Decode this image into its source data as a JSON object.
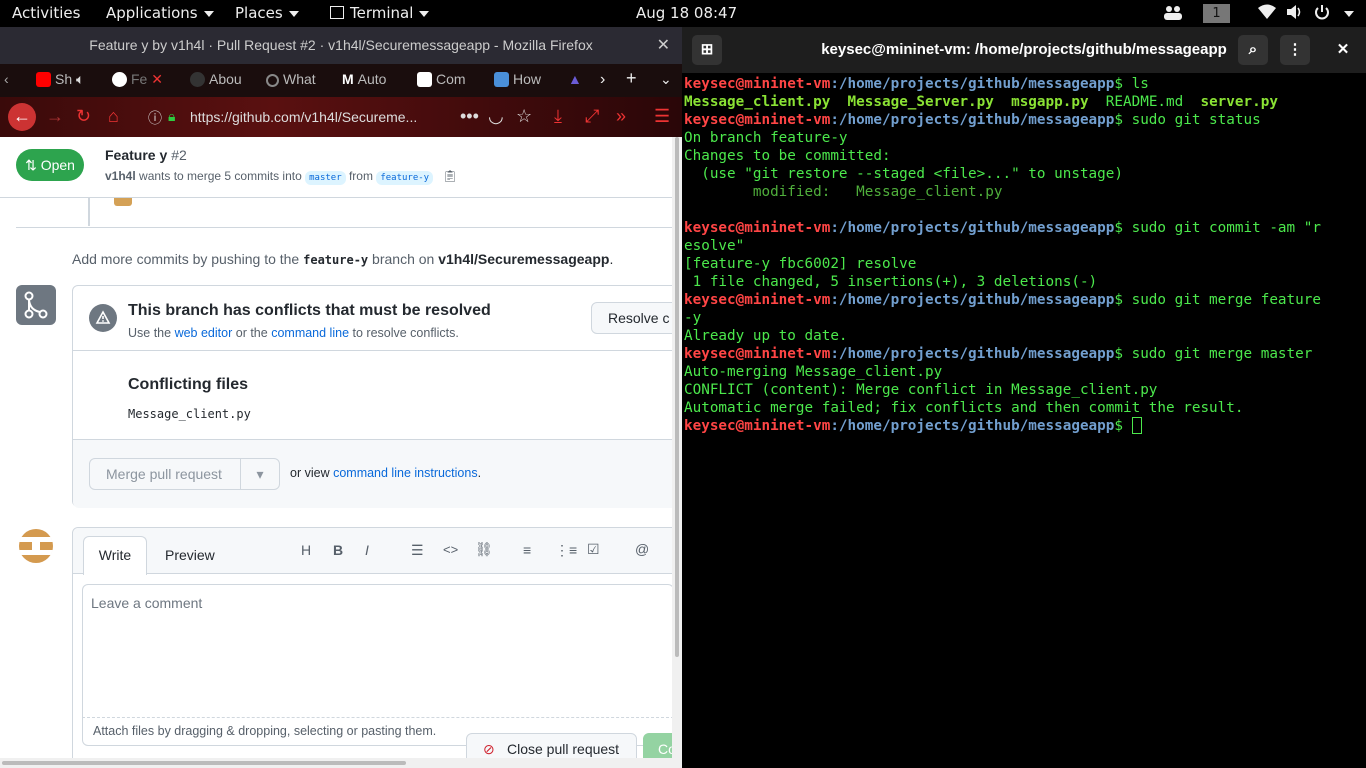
{
  "topbar": {
    "activities": "Activities",
    "applications": "Applications",
    "places": "Places",
    "terminal": "Terminal",
    "clock": "Aug 18  08:47",
    "workspace": "1"
  },
  "firefox": {
    "window_title": "Feature y by v1h4l · Pull Request #2 · v1h4l/Securemessageapp - Mozilla Firefox",
    "tabs": [
      {
        "label": "Sh",
        "icon": "youtube-icon"
      },
      {
        "label": "Fe",
        "icon": "github-icon"
      },
      {
        "label": "Abou",
        "icon": "github-icon"
      },
      {
        "label": "What",
        "icon": "circle-icon"
      },
      {
        "label": "Auto",
        "icon": "medium-icon"
      },
      {
        "label": "Com",
        "icon": "code-icon"
      },
      {
        "label": "How",
        "icon": "blog-icon"
      }
    ],
    "url": "https://github.com/v1h4l/Secureme..."
  },
  "pr": {
    "status": "Open",
    "title": "Feature y",
    "number": "#2",
    "author": "v1h4l",
    "merge_text": "wants to merge 5 commits into",
    "base_branch": "master",
    "from_word": "from",
    "head_branch": "feature-y",
    "add_commits_prefix": "Add more commits by pushing to the",
    "add_commits_branch": "feature-y",
    "add_commits_mid": "branch on",
    "add_commits_repo": "v1h4l/Securemessageapp",
    "add_commits_end": ".",
    "conflict_title": "This branch has conflicts that must be resolved",
    "conflict_use": "Use the",
    "web_editor": "web editor",
    "or_the": "or the",
    "command_line": "command line",
    "to_resolve": "to resolve conflicts.",
    "resolve_button": "Resolve c",
    "conflicting_files_title": "Conflicting files",
    "conflicting_file": "Message_client.py",
    "merge_button": "Merge pull request",
    "or_view": "or view",
    "cli_instructions": "command line instructions",
    "period": "."
  },
  "comment": {
    "write_tab": "Write",
    "preview_tab": "Preview",
    "placeholder": "Leave a comment",
    "attach_hint": "Attach files by dragging & dropping, selecting or pasting them.",
    "close_pr_button": "Close pull request",
    "comment_button": "Co"
  },
  "terminal": {
    "title": "keysec@mininet-vm: /home/projects/github/messageapp",
    "user_host": "keysec@mininet-vm",
    "path": ":/home/projects/github/messageapp",
    "prompt_end": "$ ",
    "cmd_ls": "ls",
    "ls_files": [
      "Message_client.py",
      "Message_Server.py",
      "msgapp.py",
      "README.md",
      "server.py"
    ],
    "cmd_status": "sudo git status",
    "status_lines": [
      "On branch feature-y",
      "Changes to be committed:",
      "  (use \"git restore --staged <file>...\" to unstage)",
      "        modified:   Message_client.py"
    ],
    "cmd_commit": "sudo git commit -am \"r",
    "cmd_commit_wrap": "esolve\"",
    "commit_lines": [
      "[feature-y fbc6002] resolve",
      " 1 file changed, 5 insertions(+), 3 deletions(-)"
    ],
    "cmd_merge_feature": "sudo git merge feature",
    "cmd_merge_feature_wrap": "-y",
    "merge_feature_out": "Already up to date.",
    "cmd_merge_master": "sudo git merge master",
    "merge_master_lines": [
      "Auto-merging Message_client.py",
      "CONFLICT (content): Merge conflict in Message_client.py",
      "Automatic merge failed; fix conflicts and then commit the result."
    ]
  }
}
